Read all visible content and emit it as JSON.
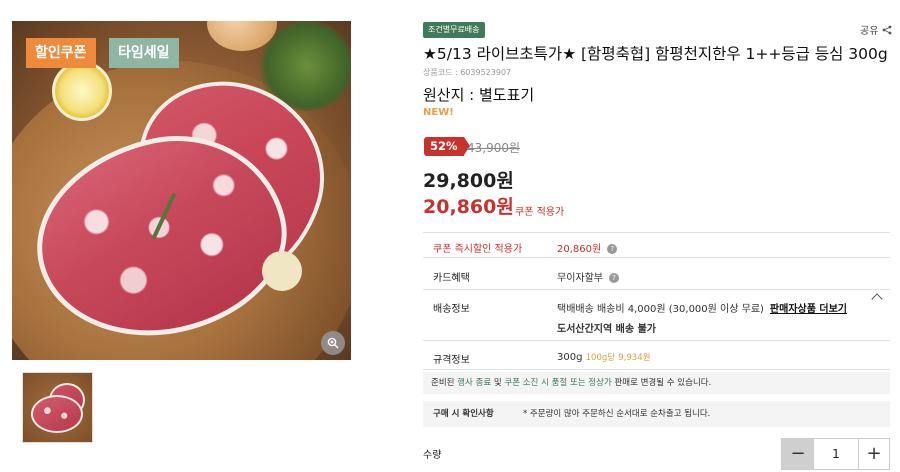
{
  "badges": {
    "coupon": "할인쿠폰",
    "timesale": "타임세일"
  },
  "shipping_tag": "조건별무료배송",
  "share_label": "공유",
  "product": {
    "title": "★5/13 라이브초특가★ [함평축협] 함평천지한우 1++등급 등심 300g",
    "code": "상품코드 : 6039523907",
    "origin": "원산지 : 별도표기",
    "new_label": "NEW!"
  },
  "price": {
    "discount_rate": "52%",
    "original": "43,900원",
    "sale": "29,800원",
    "coupon": "20,860원",
    "coupon_applied_label": "쿠폰 적용가"
  },
  "info_rows": {
    "instant_coupon": {
      "label": "쿠폰 즉시할인 적용가",
      "value": "20,860원"
    },
    "card": {
      "label": "카드혜택",
      "value": "무이자할부"
    },
    "delivery": {
      "label": "배송정보",
      "value": "택배배송  배송비 4,000원 (30,000원 이상 무료)",
      "link": "판매자상품 더보기",
      "extra": "도서산간지역 배송 불가"
    },
    "spec": {
      "label": "규격정보",
      "value": "300g",
      "unit_price_1": "100g당",
      "unit_price_2": "9,934원"
    }
  },
  "notice": {
    "part1": "준비된 ",
    "hl1": "행사 종료",
    "part2": " 및 ",
    "hl2": "쿠폰 소진 시 품절 또는 정상가",
    "part3": " 판매로 변경될 수 있습니다."
  },
  "purchase_check": {
    "label": "구매 시 확인사항",
    "value": "* 주문량이 많아 주문하신 순서대로 순차출고 됩니다."
  },
  "quantity": {
    "label": "수량",
    "value": "1",
    "minus": "−",
    "plus": "+"
  },
  "icons": {
    "zoom": "zoom-in-icon",
    "share": "share-icon",
    "help": "question-icon",
    "collapse": "chevron-up-icon"
  }
}
